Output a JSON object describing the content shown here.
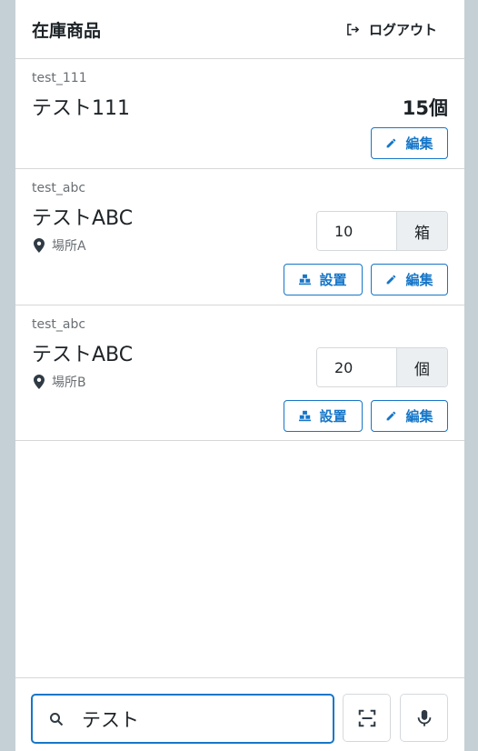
{
  "header": {
    "title": "在庫商品",
    "logout_label": "ログアウト"
  },
  "items": [
    {
      "code": "test_111",
      "name": "テスト111",
      "quantity_text": "15個",
      "edit_label": "編集"
    },
    {
      "code": "test_abc",
      "name": "テストABC",
      "location": "場所A",
      "quantity": "10",
      "unit": "箱",
      "install_label": "設置",
      "edit_label": "編集"
    },
    {
      "code": "test_abc",
      "name": "テストABC",
      "location": "場所B",
      "quantity": "20",
      "unit": "個",
      "install_label": "設置",
      "edit_label": "編集"
    }
  ],
  "search": {
    "value": "テスト"
  },
  "icons": {
    "logout": "logout-icon",
    "location": "map-pin-icon",
    "install": "boxes-icon",
    "edit": "pencil-icon",
    "search": "search-icon",
    "scan": "scan-icon",
    "mic": "microphone-icon"
  },
  "colors": {
    "accent": "#1676c8",
    "text": "#1d2327",
    "muted": "#6a6f74",
    "background": "#c5cfd6"
  }
}
